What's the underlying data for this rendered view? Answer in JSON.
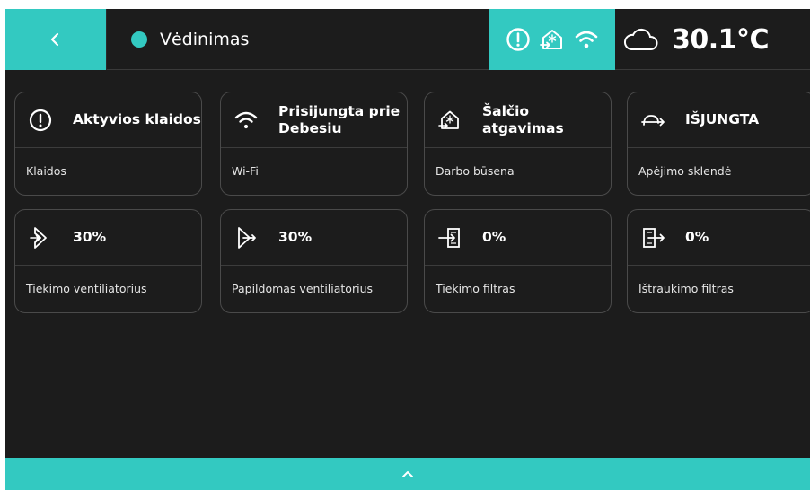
{
  "header": {
    "back_icon": "chevron-left-icon",
    "mode_label": "Vėdinimas",
    "status_icons": [
      "alert-circle-icon",
      "heat-recovery-icon",
      "wifi-icon"
    ],
    "weather_icon": "cloud-icon",
    "temperature": "30.1°C"
  },
  "cards": [
    {
      "icon": "alert-circle-icon",
      "value": "Aktyvios klaidos",
      "label": "Klaidos"
    },
    {
      "icon": "wifi-icon",
      "value": "Prisijungta prie Debesiu",
      "label": "Wi-Fi"
    },
    {
      "icon": "heat-recovery-icon",
      "value": "Šalčio atgavimas",
      "label": "Darbo būsena"
    },
    {
      "icon": "bypass-damper-icon",
      "value": "IŠJUNGTA",
      "label": "Apėjimo sklendė"
    },
    {
      "icon": "supply-fan-icon",
      "value": "30%",
      "label": "Tiekimo ventiliatorius"
    },
    {
      "icon": "additional-fan-icon",
      "value": "30%",
      "label": "Papildomas ventiliatorius"
    },
    {
      "icon": "supply-filter-icon",
      "value": "0%",
      "label": "Tiekimo filtras"
    },
    {
      "icon": "extract-filter-icon",
      "value": "0%",
      "label": "Ištraukimo filtras"
    }
  ],
  "footer": {
    "icon": "chevron-up-icon"
  },
  "colors": {
    "accent": "#33c9c1",
    "background": "#1c1c1c",
    "card_border": "#4a4a4a",
    "text": "#ffffff"
  }
}
